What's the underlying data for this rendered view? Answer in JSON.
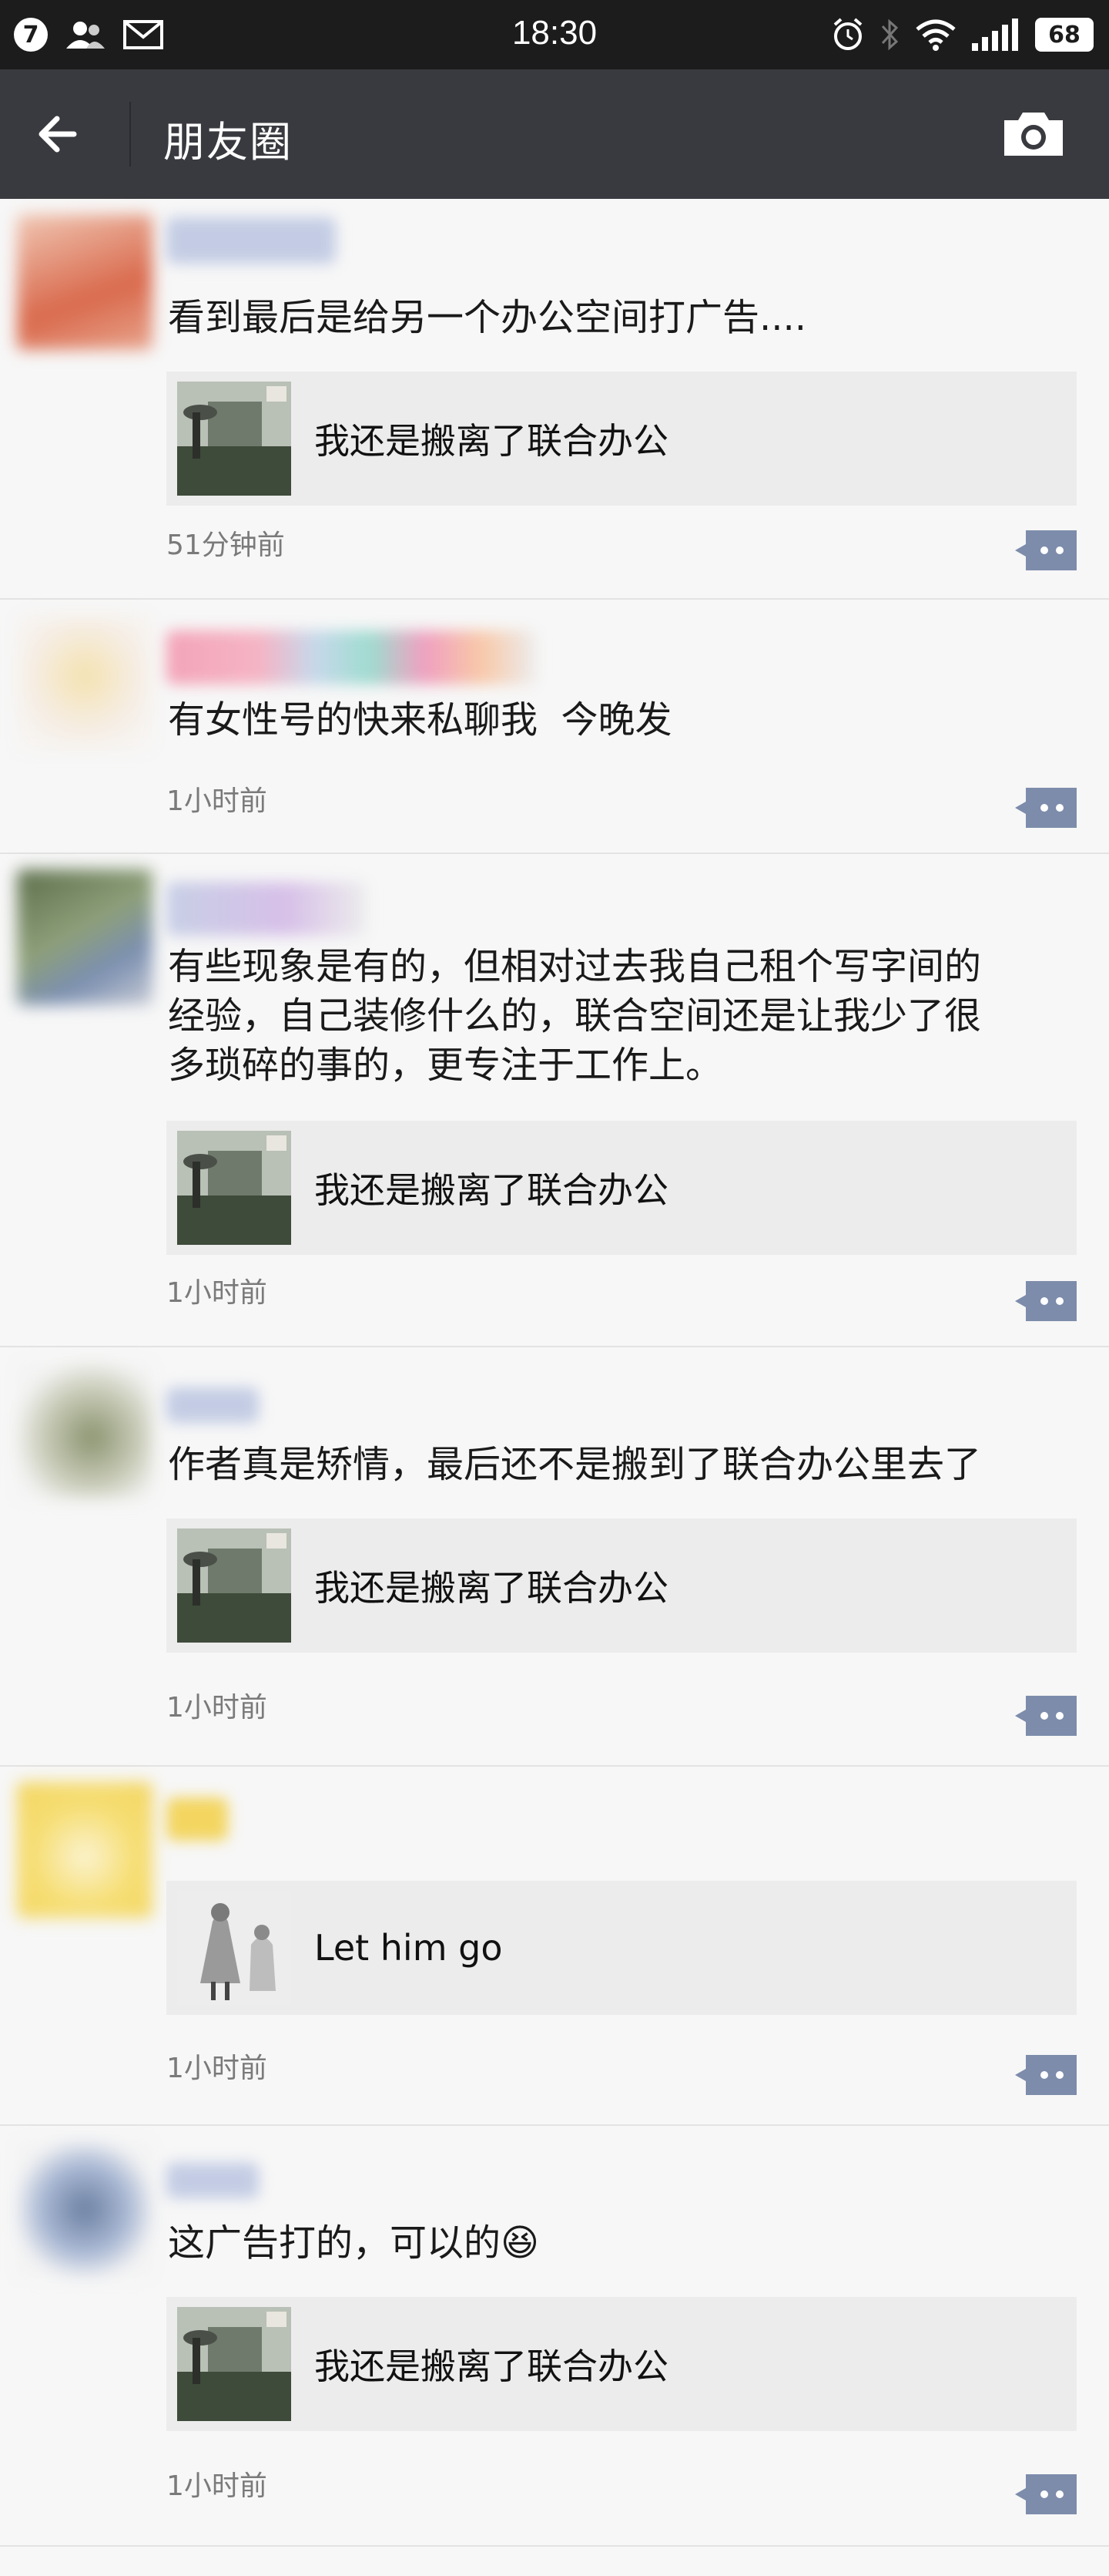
{
  "status_bar": {
    "notification_count": "7",
    "time": "18:30",
    "battery": "68"
  },
  "nav": {
    "title": "朋友圈"
  },
  "posts": [
    {
      "text": "看到最后是给另一个办公空间打广告....",
      "link_title": "我还是搬离了联合办公",
      "time": "51分钟前"
    },
    {
      "text": "有女性号的快来私聊我  今晚发",
      "time": "1小时前"
    },
    {
      "text": "有些现象是有的，但相对过去我自己租个写字间的\n经验，自己装修什么的，联合空间还是让我少了很\n多琐碎的事的，更专注于工作上。",
      "link_title": "我还是搬离了联合办公",
      "time": "1小时前"
    },
    {
      "text": "作者真是矫情，最后还不是搬到了联合办公里去了",
      "link_title": "我还是搬离了联合办公",
      "time": "1小时前"
    },
    {
      "link_title": "Let him go",
      "time": "1小时前"
    },
    {
      "text": "这广告打的，可以的😆",
      "link_title": "我还是搬离了联合办公",
      "time": "1小时前"
    }
  ],
  "colors": {
    "status_bar_bg": "#1c1c1c",
    "nav_bg": "#393a3f",
    "feed_bg": "#f7f7f7",
    "link_card_bg": "#ececec",
    "comment_icon": "#7d8cab"
  },
  "icons": [
    "back-arrow-icon",
    "camera-icon",
    "comment-icon",
    "alarm-icon",
    "bluetooth-icon",
    "wifi-icon",
    "signal-icon",
    "contacts-icon",
    "mail-icon"
  ]
}
